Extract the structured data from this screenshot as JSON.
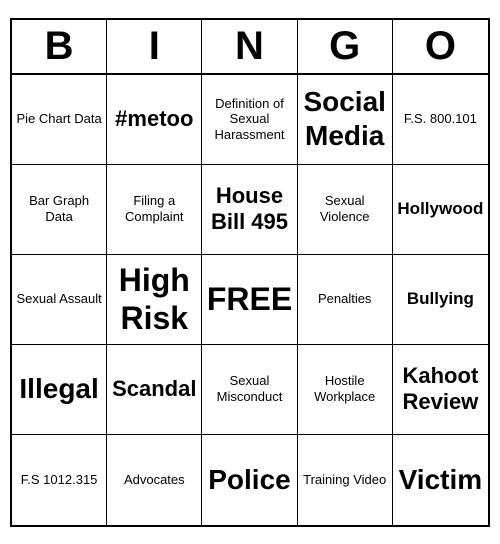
{
  "header": {
    "letters": [
      "B",
      "I",
      "N",
      "G",
      "O"
    ]
  },
  "cells": [
    {
      "text": "Pie Chart Data",
      "size": "normal"
    },
    {
      "text": "#metoo",
      "size": "large"
    },
    {
      "text": "Definition of Sexual Harassment",
      "size": "small"
    },
    {
      "text": "Social Media",
      "size": "xl"
    },
    {
      "text": "F.S. 800.101",
      "size": "normal"
    },
    {
      "text": "Bar Graph Data",
      "size": "normal"
    },
    {
      "text": "Filing a Complaint",
      "size": "normal"
    },
    {
      "text": "House Bill 495",
      "size": "large"
    },
    {
      "text": "Sexual Violence",
      "size": "normal"
    },
    {
      "text": "Hollywood",
      "size": "medium"
    },
    {
      "text": "Sexual Assault",
      "size": "normal"
    },
    {
      "text": "High Risk",
      "size": "xxl"
    },
    {
      "text": "FREE",
      "size": "xxl"
    },
    {
      "text": "Penalties",
      "size": "normal"
    },
    {
      "text": "Bullying",
      "size": "medium"
    },
    {
      "text": "Illegal",
      "size": "xl"
    },
    {
      "text": "Scandal",
      "size": "large"
    },
    {
      "text": "Sexual Misconduct",
      "size": "small"
    },
    {
      "text": "Hostile Workplace",
      "size": "small"
    },
    {
      "text": "Kahoot Review",
      "size": "large"
    },
    {
      "text": "F.S 1012.315",
      "size": "normal"
    },
    {
      "text": "Advocates",
      "size": "normal"
    },
    {
      "text": "Police",
      "size": "xl"
    },
    {
      "text": "Training Video",
      "size": "normal"
    },
    {
      "text": "Victim",
      "size": "xl"
    }
  ]
}
